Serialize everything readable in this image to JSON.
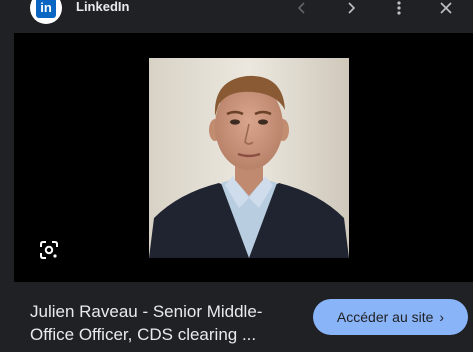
{
  "header": {
    "source_name": "LinkedIn",
    "logo_text": "in",
    "icons": [
      "linkedin-logo-icon",
      "chevron-left-icon",
      "chevron-right-icon",
      "more-vert-icon",
      "close-icon"
    ]
  },
  "result": {
    "title_line1": "Julien Raveau - Senior Middle-",
    "title_line2": "Office Officer, CDS clearing ...",
    "visit_label": "Accéder au site",
    "visit_chevron": "›"
  },
  "colors": {
    "panel_bg": "#202124",
    "stage_bg": "#000000",
    "button_bg": "#8ab4f8",
    "linkedin_blue": "#0a66c2",
    "text": "#e8eaed"
  }
}
